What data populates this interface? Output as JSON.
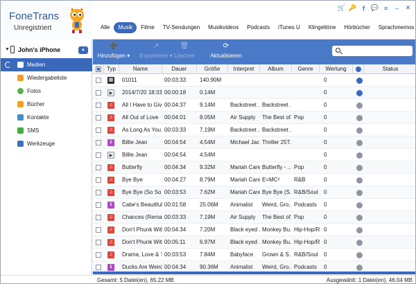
{
  "app": {
    "title": "FoneTrans",
    "subtitle": "Unregistriert"
  },
  "categories": [
    "Alle",
    "Musik",
    "Filme",
    "TV-Sendungen",
    "Musikvideos",
    "Podcasts",
    "iTunes U",
    "Klingeltöne",
    "Hörbücher",
    "Sprachmemos"
  ],
  "active_category": "Musik",
  "device": {
    "name": "John's iPhone"
  },
  "sidebar": {
    "items": [
      {
        "label": "Medien",
        "icon": "media-icon",
        "color": "#3a69bb"
      },
      {
        "label": "Wiedergabeliste",
        "icon": "playlist-icon",
        "color": "#f29b2b"
      },
      {
        "label": "Fotos",
        "icon": "photos-icon",
        "color": "#5ab04c"
      },
      {
        "label": "Bücher",
        "icon": "books-icon",
        "color": "#f0a21a"
      },
      {
        "label": "Kontakte",
        "icon": "contacts-icon",
        "color": "#3a8fd6"
      },
      {
        "label": "SMS",
        "icon": "sms-icon",
        "color": "#3fae3f"
      },
      {
        "label": "Werkzeuge",
        "icon": "tools-icon",
        "color": "#3a73c4"
      }
    ]
  },
  "toolbar": {
    "add_label": "Hinzufügen",
    "export_label": "Exportieren",
    "delete_label": "Löschen",
    "refresh_label": "Aktualisieren",
    "search_placeholder": ""
  },
  "table": {
    "columns": [
      "Typ",
      "Name",
      "Dauer",
      "Größe",
      "Interpret",
      "Album",
      "Genre",
      "Wertung",
      "Status"
    ],
    "rows": [
      {
        "type": "movie",
        "name": "01011",
        "duration": "00:03:33",
        "size": "140.90M",
        "artist": "",
        "album": "",
        "genre": "",
        "rating": "0",
        "sync": "blue"
      },
      {
        "type": "clip",
        "name": "2014/7/20 18:33",
        "duration": "00:00:18",
        "size": "0.14M",
        "artist": "",
        "album": "",
        "genre": "",
        "rating": "0",
        "sync": "blue"
      },
      {
        "type": "music",
        "name": "All I Have to Give",
        "duration": "00:04:37",
        "size": "9.14M",
        "artist": "Backstreet ...",
        "album": "Backstreet ...",
        "genre": "",
        "rating": "0",
        "sync": "gray"
      },
      {
        "type": "music",
        "name": "All Out of Love",
        "duration": "00:04:01",
        "size": "8.05M",
        "artist": "Air Supply",
        "album": "The Best of...",
        "genre": "Pop",
        "rating": "0",
        "sync": "gray"
      },
      {
        "type": "music",
        "name": "As Long As You Lo...",
        "duration": "00:03:33",
        "size": "7.19M",
        "artist": "Backstreet ...",
        "album": "Backstreet ...",
        "genre": "",
        "rating": "0",
        "sync": "gray"
      },
      {
        "type": "video",
        "name": "Billie Jean",
        "duration": "00:04:54",
        "size": "4.54M",
        "artist": "Michael Jac...",
        "album": "Thriller 25T...",
        "genre": "",
        "rating": "0",
        "sync": "gray"
      },
      {
        "type": "clip",
        "name": "Billie Jean",
        "duration": "00:04:54",
        "size": "4.54M",
        "artist": "",
        "album": "",
        "genre": "",
        "rating": "0",
        "sync": "gray"
      },
      {
        "type": "music",
        "name": "Butterfly",
        "duration": "00:04:34",
        "size": "9.32M",
        "artist": "Mariah Carey",
        "album": "Butterfly - ...",
        "genre": "Pop",
        "rating": "0",
        "sync": "gray"
      },
      {
        "type": "music",
        "name": "Bye Bye",
        "duration": "00:04:27",
        "size": "8.79M",
        "artist": "Mariah Carey",
        "album": "E=MC²",
        "genre": "R&B",
        "rating": "0",
        "sync": "gray"
      },
      {
        "type": "music",
        "name": "Bye Bye (So So De...",
        "duration": "00:03:53",
        "size": "7.62M",
        "artist": "Mariah Carey",
        "album": "Bye Bye (S...",
        "genre": "R&B/Soul",
        "rating": "0",
        "sync": "gray"
      },
      {
        "type": "video",
        "name": "Cabe's Beautiful Bl...",
        "duration": "00:01:58",
        "size": "25.06M",
        "artist": "Animalist",
        "album": "Weird, Gro...",
        "genre": "Podcasts",
        "rating": "0",
        "sync": "gray"
      },
      {
        "type": "music",
        "name": "Chances (Remaste...",
        "duration": "00:03:33",
        "size": "7.19M",
        "artist": "Air Supply",
        "album": "The Best of...",
        "genre": "Pop",
        "rating": "0",
        "sync": "gray"
      },
      {
        "type": "music",
        "name": "Don't Phunk With ...",
        "duration": "00:04:34",
        "size": "7.20M",
        "artist": "Black eyed ...",
        "album": "Monkey Bu...",
        "genre": "Hip-Hop/Rap",
        "rating": "0",
        "sync": "gray"
      },
      {
        "type": "music",
        "name": "Don't Phunk With ...",
        "duration": "00:05:11",
        "size": "6.97M",
        "artist": "Black eyed ...",
        "album": "Monkey Bu...",
        "genre": "Hip-Hop/Rap",
        "rating": "0",
        "sync": "gray"
      },
      {
        "type": "music",
        "name": "Drama, Love & 'Lat...",
        "duration": "00:03:53",
        "size": "7.84M",
        "artist": "Babyface",
        "album": "Grown & S...",
        "genre": "R&B/Soul",
        "rating": "0",
        "sync": "gray"
      },
      {
        "type": "video",
        "name": "Ducks Are Weird, ...",
        "duration": "00:04:34",
        "size": "90.36M",
        "artist": "Animalist",
        "album": "Weird, Gro...",
        "genre": "Podcasts",
        "rating": "0",
        "sync": "gray"
      }
    ]
  },
  "status": {
    "total": "Gesamt: 5 Datei(en), 65.22 MB",
    "selected": "Ausgewählt: 1 Datei(en), 46.04 MB"
  },
  "colors": {
    "accent": "#3a69bb",
    "toolbar": "#4a79c8",
    "brand": "#2a5aa8"
  }
}
